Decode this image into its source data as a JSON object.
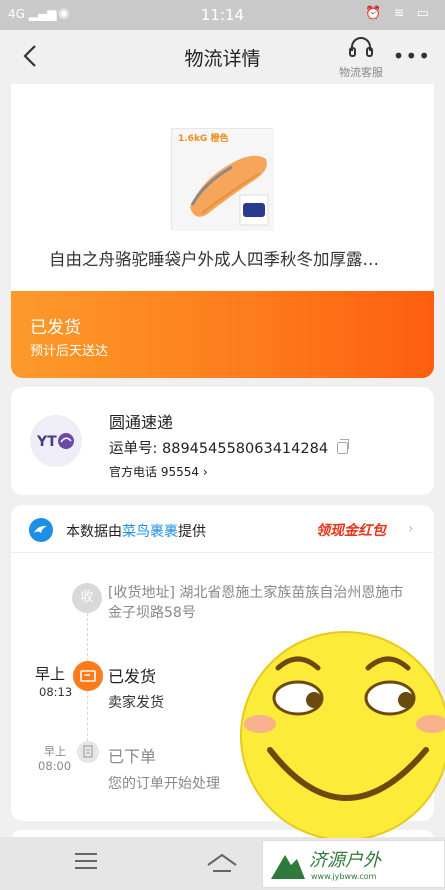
{
  "status_bar": {
    "signal": "4G",
    "time": "11:14"
  },
  "header": {
    "title": "物流详情",
    "service_label": "物流客服"
  },
  "product": {
    "image_badge": "1.6kG 橙色",
    "title": "自由之舟骆驼睡袋户外成人四季秋冬加厚露…"
  },
  "shipment": {
    "status": "已发货",
    "eta": "预计后天送达"
  },
  "carrier": {
    "logo_text": "YT",
    "name": "圆通速递",
    "tracking_label": "运单号:",
    "tracking_number": "889454558063414284",
    "phone_label": "官方电话",
    "phone_number": "95554"
  },
  "data_source": {
    "prefix": "本数据由",
    "provider": "菜鸟裹裹",
    "suffix": "提供",
    "promo": "领现金红包"
  },
  "timeline": [
    {
      "node": "收",
      "text": "[收货地址] 湖北省恩施土家族苗族自治州恩施市 金子坝路58号"
    },
    {
      "day": "早上",
      "time": "08:13",
      "status": "已发货",
      "detail": "卖家发货"
    },
    {
      "day": "早上",
      "time": "08:00",
      "status": "已下单",
      "detail": "您的订单开始处理"
    }
  ],
  "watermark": {
    "text": "济源户外",
    "url": "www.jybww.com"
  },
  "colors": {
    "accent_orange": "#fd7a1a",
    "cainiao_blue": "#1d8fe4",
    "promo_red": "#e8351c"
  }
}
